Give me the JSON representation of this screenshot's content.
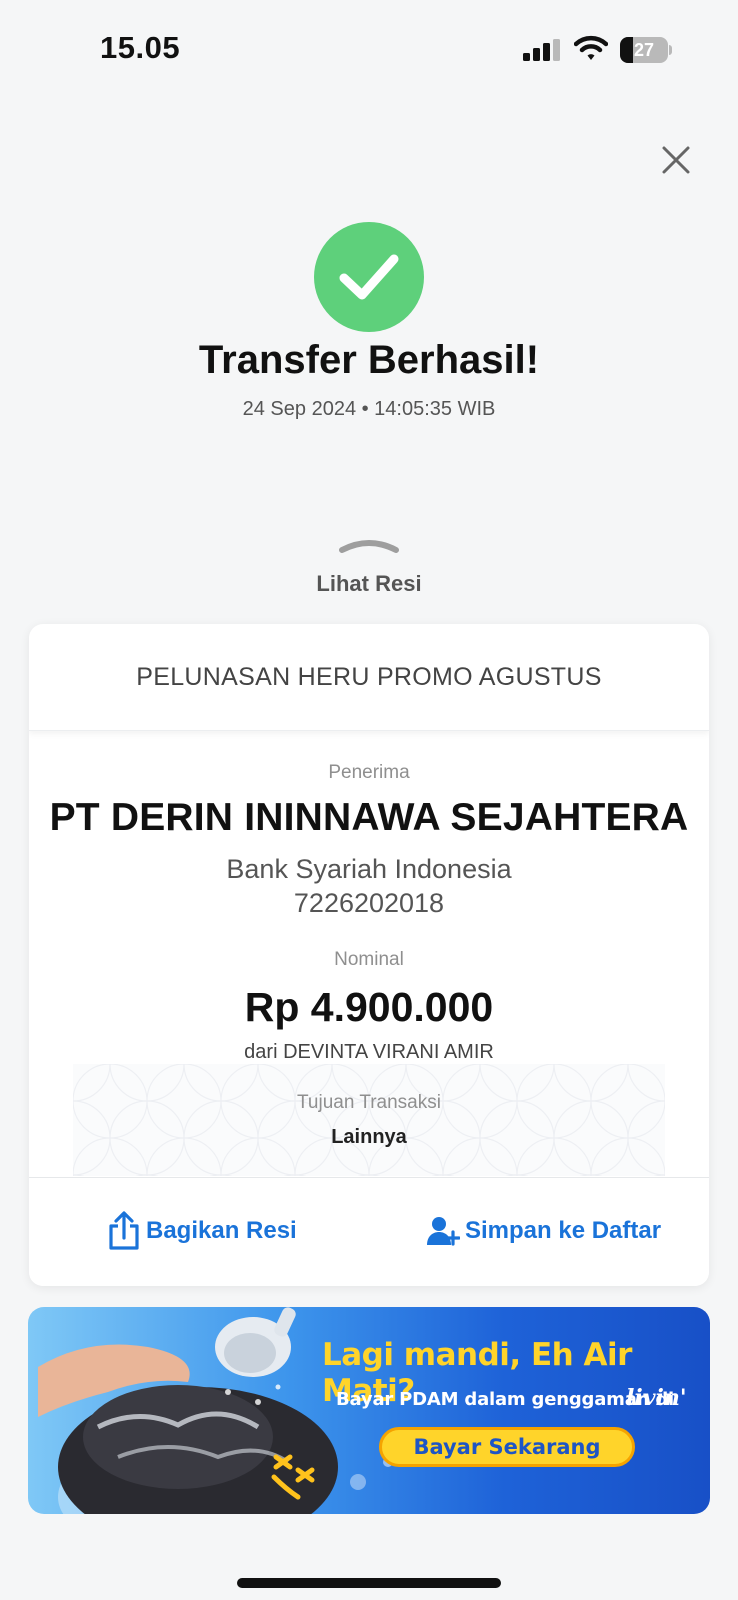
{
  "status_bar": {
    "time": "15.05",
    "battery_level": "27",
    "battery_fraction": 0.27
  },
  "result": {
    "title": "Transfer Berhasil!",
    "timestamp": "24 Sep 2024 • 14:05:35 WIB",
    "toggle_label": "Lihat Resi",
    "success_color": "#5ed07b"
  },
  "receipt": {
    "header": "PELUNASAN HERU PROMO AGUSTUS",
    "recipient_label": "Penerima",
    "recipient_name": "PT DERIN ININNAWA SEJAHTERA",
    "bank_name": "Bank Syariah Indonesia",
    "account_number": "7226202018",
    "amount_label": "Nominal",
    "amount": "Rp 4.900.000",
    "sender": "dari DEVINTA VIRANI AMIR",
    "purpose_label": "Tujuan Transaksi",
    "purpose": "Lainnya"
  },
  "actions": {
    "share_label": "Bagikan Resi",
    "save_label": "Simpan ke Daftar",
    "accent_color": "#1a73d9"
  },
  "banner": {
    "headline": "Lagi mandi, Eh Air Mati?",
    "subtext": "Bayar PDAM dalam genggaman di",
    "brand": "livin'",
    "cta": "Bayar Sekarang"
  }
}
